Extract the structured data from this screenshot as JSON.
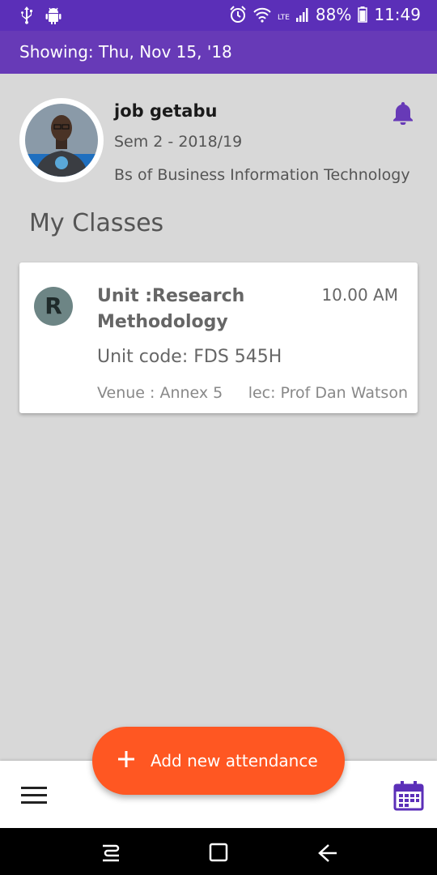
{
  "status_bar": {
    "battery": "88%",
    "time": "11:49",
    "network": "LTE",
    "icons": [
      "usb-icon",
      "android-icon",
      "alarm-icon",
      "wifi-icon",
      "signal-icon",
      "battery-icon"
    ]
  },
  "app_bar": {
    "title": "Showing: Thu, Nov 15, '18"
  },
  "profile": {
    "name": "job getabu",
    "semester": "Sem 2 - 2018/19",
    "course": "Bs of Business Information Technology",
    "notification_icon": "bell-icon"
  },
  "section": {
    "title": "My Classes"
  },
  "classes": [
    {
      "avatar_letter": "R",
      "unit": "Unit :Research Methodology",
      "time": "10.00 AM",
      "code": "Unit code: FDS 545H",
      "venue": "Venue : Annex 5",
      "lecturer": "lec: Prof Dan Watson"
    }
  ],
  "fab": {
    "label": "Add new attendance",
    "icon": "plus-icon"
  },
  "bottom_bar": {
    "menu_icon": "menu-icon",
    "calendar_icon": "calendar-icon"
  },
  "nav_bar": {
    "icons": [
      "recents-icon",
      "home-icon",
      "back-icon"
    ]
  },
  "colors": {
    "primary": "#673ab7",
    "status_bar": "#5b2fb8",
    "accent": "#ff5722",
    "background": "#d8d8d8"
  }
}
